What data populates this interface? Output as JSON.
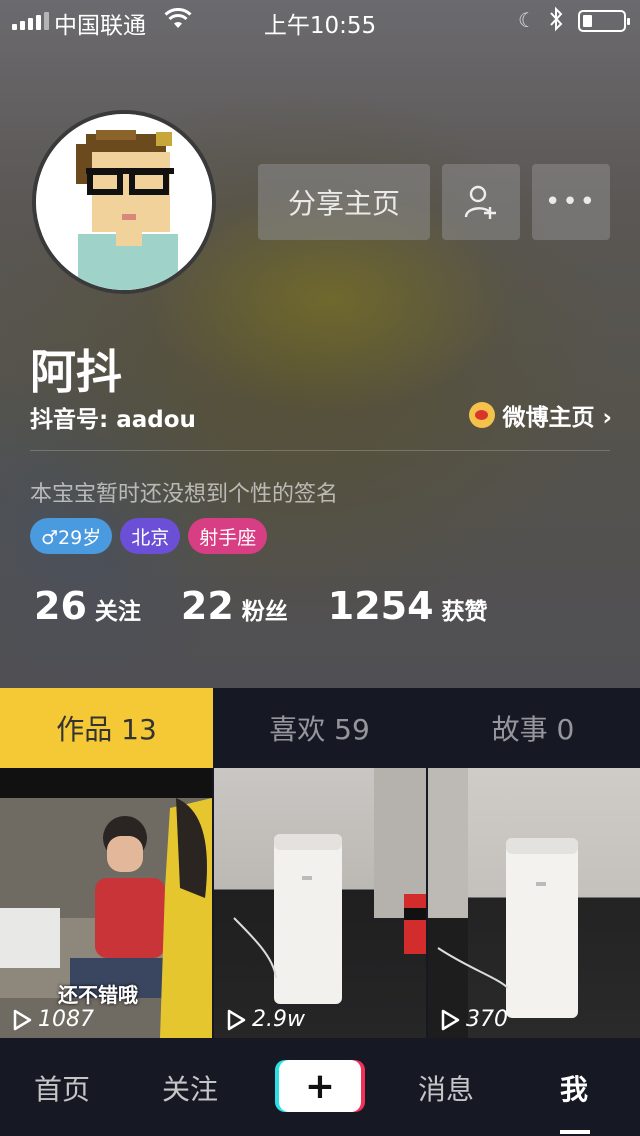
{
  "status": {
    "carrier": "中国联通",
    "time": "上午10:55"
  },
  "profile": {
    "name": "阿抖",
    "douyin_id": "抖音号: aadou",
    "weibo_label": "微博主页 ›",
    "signature": "本宝宝暂时还没想到个性的签名",
    "tags": {
      "age": "♂29岁",
      "city": "北京",
      "zodiac": "射手座"
    },
    "stats": [
      {
        "num": "26",
        "label": "关注"
      },
      {
        "num": "22",
        "label": "粉丝"
      },
      {
        "num": "1254",
        "label": "获赞"
      }
    ]
  },
  "actions": {
    "share": "分享主页",
    "more": "•••"
  },
  "tabs": [
    {
      "label": "作品 13"
    },
    {
      "label": "喜欢 59"
    },
    {
      "label": "故事 0"
    }
  ],
  "videos": [
    {
      "plays": "1087",
      "subtitle": "还不错哦"
    },
    {
      "plays": "2.9w"
    },
    {
      "plays": "370"
    }
  ],
  "nav": {
    "home": "首页",
    "follow": "关注",
    "plus": "+",
    "messages": "消息",
    "me": "我"
  },
  "colors": {
    "accent": "#f5c935",
    "background": "#161823"
  },
  "icons": [
    "signal-icon",
    "wifi-icon",
    "moon-icon",
    "bluetooth-icon",
    "battery-icon",
    "add-friend-icon",
    "weibo-icon",
    "play-icon"
  ]
}
